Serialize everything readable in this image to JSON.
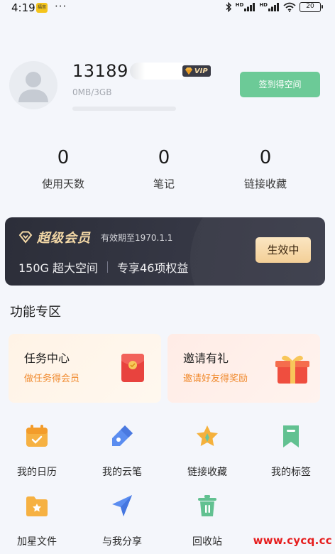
{
  "status_bar": {
    "time": "4:19",
    "app_badge": "福音",
    "dots": "···",
    "battery": "20"
  },
  "profile": {
    "name": "13189",
    "vip_label": "VIP",
    "storage": "0MB/3GB",
    "storage_used_fraction": 0.0,
    "checkin_label": "签到得空间"
  },
  "stats": [
    {
      "value": "0",
      "label": "使用天数"
    },
    {
      "value": "0",
      "label": "笔记"
    },
    {
      "value": "0",
      "label": "链接收藏"
    }
  ],
  "vip_card": {
    "title": "超级会员",
    "expiry": "有效期至1970.1.1",
    "benefit_1": "150G 超大空间",
    "benefit_2": "专享46项权益",
    "action": "生效中"
  },
  "features": {
    "section_title": "功能专区",
    "task": {
      "title": "任务中心",
      "subtitle": "做任务得会员"
    },
    "invite": {
      "title": "邀请有礼",
      "subtitle": "邀请好友得奖励"
    }
  },
  "grid": [
    {
      "label": "我的日历",
      "icon": "calendar-icon"
    },
    {
      "label": "我的云笔",
      "icon": "cloud-pen-icon"
    },
    {
      "label": "链接收藏",
      "icon": "star-link-icon"
    },
    {
      "label": "我的标签",
      "icon": "bookmark-icon"
    },
    {
      "label": "加星文件",
      "icon": "star-folder-icon"
    },
    {
      "label": "与我分享",
      "icon": "share-icon"
    },
    {
      "label": "回收站",
      "icon": "trash-icon"
    }
  ],
  "watermark": "www.cycq.cc",
  "colors": {
    "accent_green": "#6cca97",
    "vip_gold": "#f3d8a6",
    "vip_dark": "#2c2e39",
    "orange": "#f08a2e"
  }
}
